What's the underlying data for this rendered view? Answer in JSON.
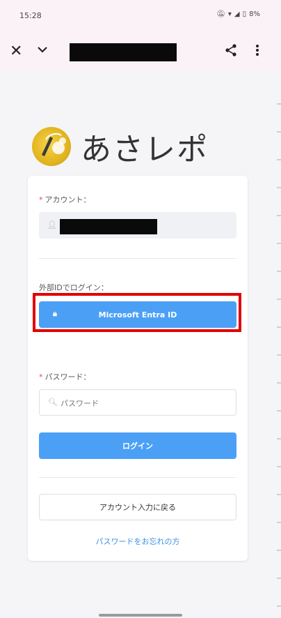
{
  "status_bar": {
    "time": "15:28",
    "battery": "8%",
    "icons": [
      "mute-icon",
      "wifi-icon",
      "signal-icon",
      "battery-icon"
    ]
  },
  "toolbar": {
    "close_icon": "close-icon",
    "dropdown_icon": "chevron-down-icon",
    "share_icon": "share-icon",
    "menu_icon": "more-vert-icon"
  },
  "logo": {
    "text": "あさレポ"
  },
  "form": {
    "account_label": "アカウント：",
    "external_login_label": "外部IDでログイン：",
    "entra_button": "Microsoft Entra ID",
    "password_label": "パスワード：",
    "password_placeholder": "パスワード",
    "login_button": "ログイン",
    "back_button": "アカウント入力に戻る",
    "forgot_link": "パスワードをお忘れの方"
  },
  "colors": {
    "accent": "#4ba0f6",
    "required": "#e34b4b",
    "highlight": "#e00000",
    "link": "#3b8fe8"
  }
}
